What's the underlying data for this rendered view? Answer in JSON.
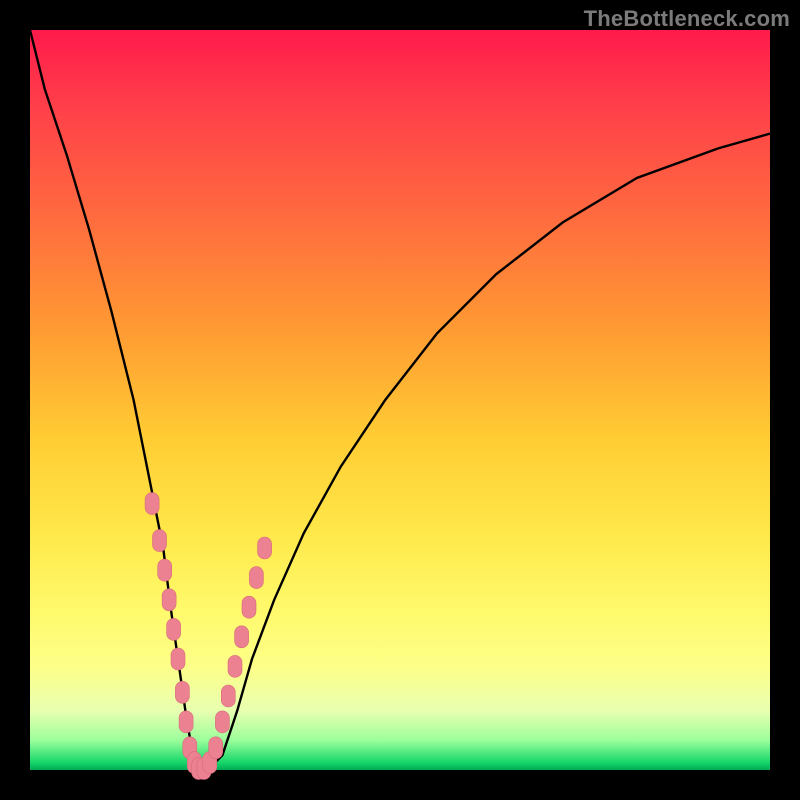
{
  "watermark": "TheBottleneck.com",
  "colors": {
    "page_bg": "#000000",
    "gradient_top": "#ff1a4b",
    "gradient_bottom": "#00aa55",
    "curve": "#000000",
    "marker_fill": "#ec8291",
    "marker_stroke": "#d86a7a"
  },
  "chart_data": {
    "type": "line",
    "title": "",
    "xlabel": "",
    "ylabel": "",
    "x_range": [
      0,
      100
    ],
    "y_range": [
      0,
      100
    ],
    "grid": false,
    "note": "V-shaped bottleneck curve overlaid on red→green gradient. Lower y = less bottleneck (green). Values estimated from pixel positions; no axis labels present in source.",
    "series": [
      {
        "name": "bottleneck-curve",
        "x": [
          0,
          2,
          5,
          8,
          11,
          14,
          16,
          18,
          19,
          20,
          21,
          22,
          23,
          24,
          26,
          28,
          30,
          33,
          37,
          42,
          48,
          55,
          63,
          72,
          82,
          93,
          100
        ],
        "y": [
          100,
          92,
          83,
          73,
          62,
          50,
          40,
          30,
          22,
          15,
          8,
          2,
          0,
          0,
          2,
          8,
          15,
          23,
          32,
          41,
          50,
          59,
          67,
          74,
          80,
          84,
          86
        ]
      }
    ],
    "markers": {
      "name": "sample-points",
      "x": [
        16.5,
        17.5,
        18.2,
        18.8,
        19.4,
        20.0,
        20.6,
        21.1,
        21.6,
        22.2,
        22.8,
        23.5,
        24.3,
        25.1,
        26.0,
        26.8,
        27.7,
        28.6,
        29.6,
        30.6,
        31.7
      ],
      "y": [
        36.0,
        31.0,
        27.0,
        23.0,
        19.0,
        15.0,
        10.5,
        6.5,
        3.0,
        1.0,
        0.2,
        0.2,
        1.0,
        3.0,
        6.5,
        10.0,
        14.0,
        18.0,
        22.0,
        26.0,
        30.0
      ]
    }
  }
}
